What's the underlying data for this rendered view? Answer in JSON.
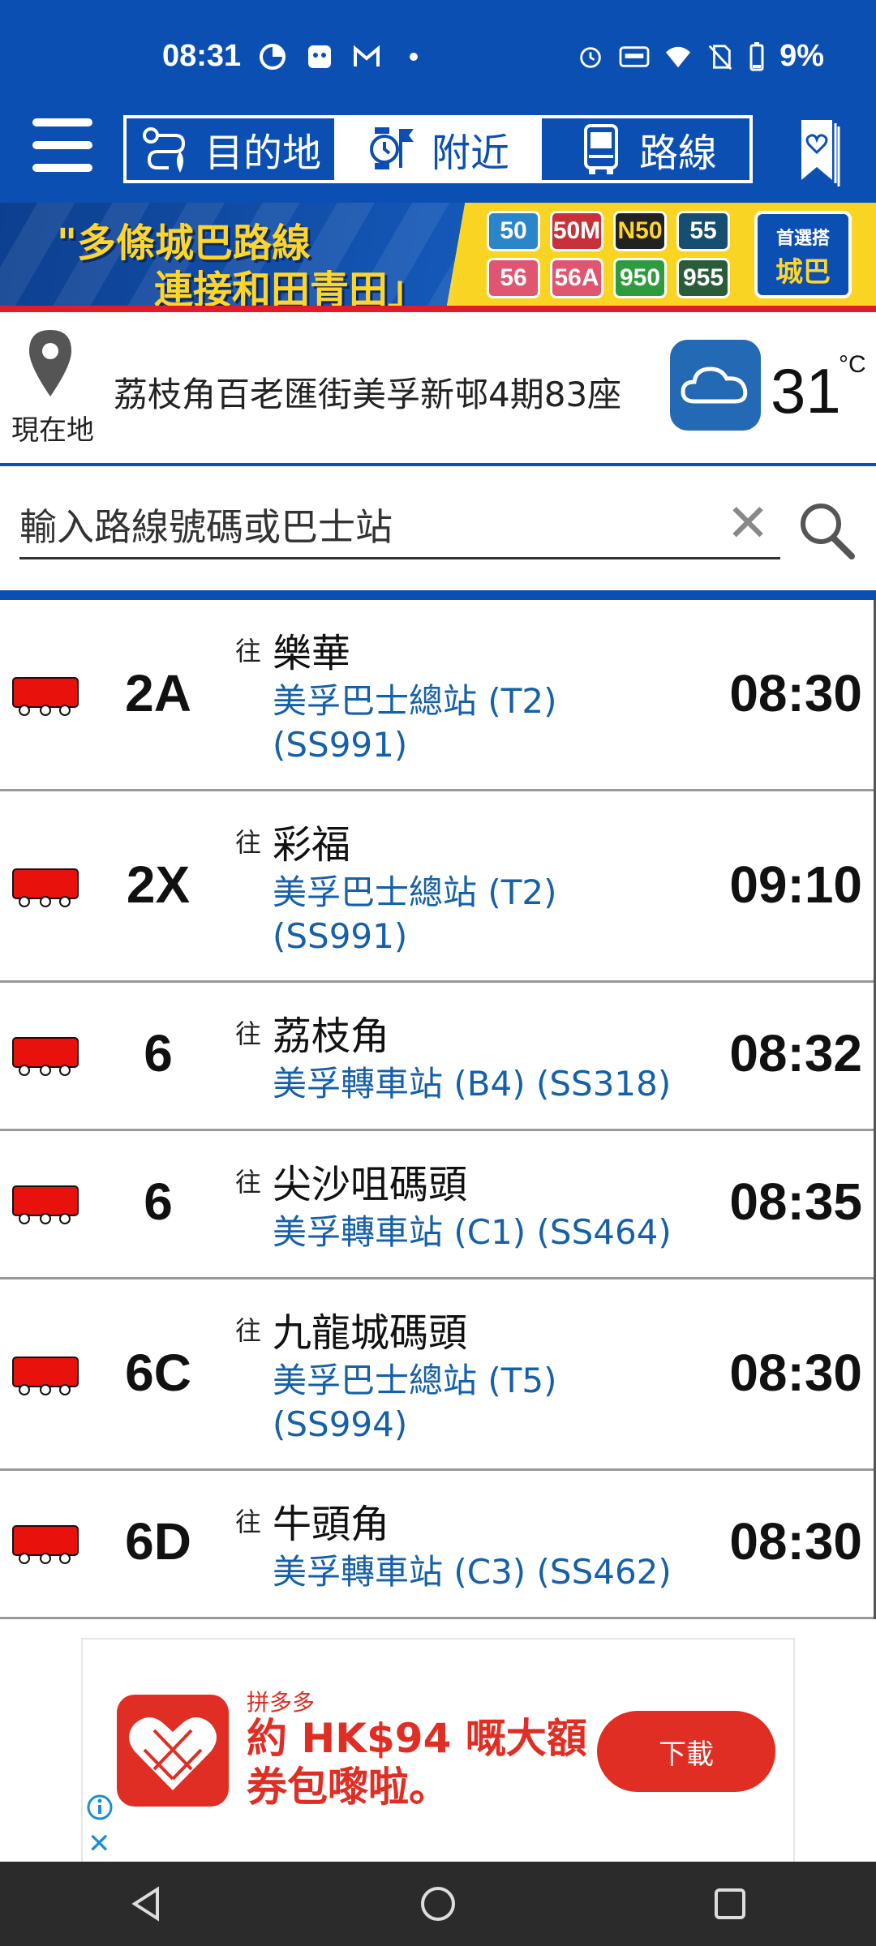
{
  "status_bar": {
    "time": "08:31",
    "battery": "9%"
  },
  "tabs": [
    {
      "label": "目的地",
      "icon": "route-icon"
    },
    {
      "label": "附近",
      "icon": "nearby-clock-icon"
    },
    {
      "label": "路線",
      "icon": "bus-front-icon"
    }
  ],
  "banner": {
    "line1": "\"多條城巴路線",
    "line2": "連接和田青田」",
    "routes": [
      "50",
      "50M",
      "N50",
      "55",
      "56",
      "56A",
      "950",
      "955"
    ],
    "brand_top": "首選搭",
    "brand_main": "城巴"
  },
  "location": {
    "label": "現在地",
    "address": "荔枝角百老匯街美孚新邨4期83座",
    "temperature": "31",
    "unit": "°C",
    "weather_icon": "cloud-icon"
  },
  "search": {
    "placeholder": "輸入路線號碼或巴士站",
    "clear": "✕"
  },
  "towards_label": "往",
  "routes": [
    {
      "route": "2A",
      "destination": "樂華",
      "stop": "美孚巴士總站 (T2) (SS991)",
      "eta": "08:30"
    },
    {
      "route": "2X",
      "destination": "彩福",
      "stop": "美孚巴士總站 (T2) (SS991)",
      "eta": "09:10"
    },
    {
      "route": "6",
      "destination": "荔枝角",
      "stop": "美孚轉車站 (B4) (SS318)",
      "eta": "08:32"
    },
    {
      "route": "6",
      "destination": "尖沙咀碼頭",
      "stop": "美孚轉車站 (C1) (SS464)",
      "eta": "08:35"
    },
    {
      "route": "6C",
      "destination": "九龍城碼頭",
      "stop": "美孚巴士總站 (T5) (SS994)",
      "eta": "08:30"
    },
    {
      "route": "6D",
      "destination": "牛頭角",
      "stop": "美孚轉車站 (C3) (SS462)",
      "eta": "08:30"
    }
  ],
  "ad": {
    "brand": "拼多多",
    "text": "約 HK$94 嘅大額券包嚟啦。",
    "button": "下載"
  },
  "colors": {
    "primary": "#0b4fb3",
    "bus_red": "#e8110c",
    "link_blue": "#1560a8",
    "ad_red": "#e02e24"
  }
}
